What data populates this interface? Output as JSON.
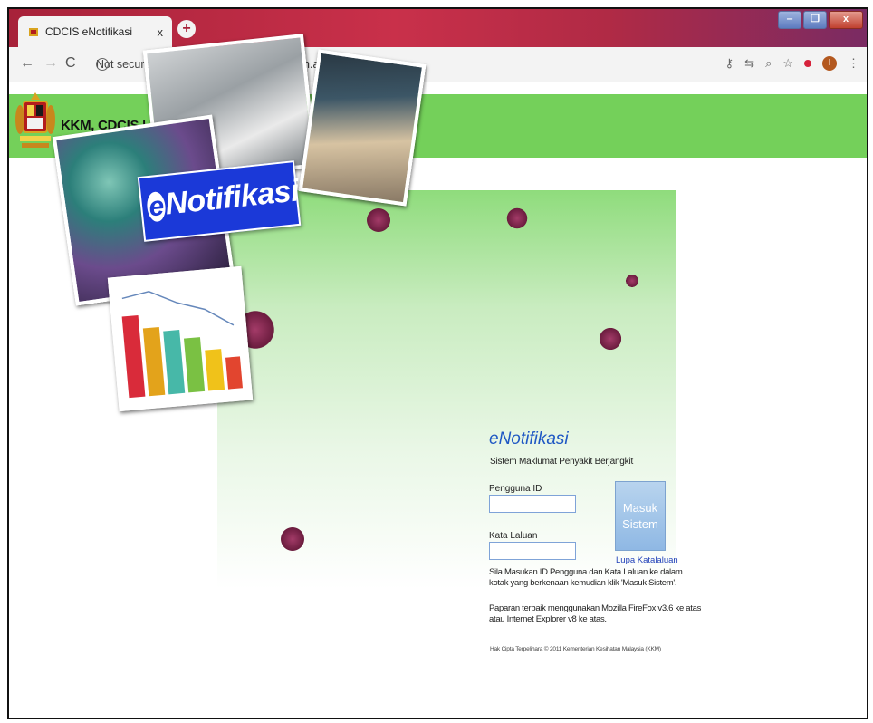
{
  "browser": {
    "tab_title": "CDCIS eNotifikasi",
    "tab_close": "x",
    "new_tab": "+",
    "win_min": "‒",
    "win_max": "❐",
    "win_close": "x",
    "security_label": "Not secure",
    "url": "enotifikasi.moh.gov.my/Login.aspx",
    "icons": [
      "key-icon",
      "translate-icon",
      "zoom-icon",
      "star-icon",
      "extension-icon",
      "profile-icon",
      "menu-icon"
    ],
    "profile_initial": "I"
  },
  "header": {
    "title": "KKM, CDCIS | e-Notifikasi",
    "bg_color": "#74d05a"
  },
  "splash": {
    "banner_e": "e",
    "banner_word": "Notifikasi"
  },
  "login": {
    "app_name": "eNotifikasi",
    "app_subtitle": "Sistem Maklumat Penyakit Berjangkit",
    "user_label": "Pengguna ID",
    "user_value": "",
    "password_label": "Kata Laluan",
    "password_value": "",
    "submit_line1": "Masuk",
    "submit_line2": "Sistem",
    "forgot_link": "Lupa Katalaluan",
    "instruction_1": "Sila Masukan ID Pengguna dan Kata Laluan ke dalam",
    "instruction_2": "kotak yang berkenaan kemudian klik 'Masuk Sistem'.",
    "browser_note_1": "Paparan terbaik menggunakan Mozilla FireFox v3.6 ke atas",
    "browser_note_2": "atau Internet Explorer v8 ke atas.",
    "copyright": "Hak Cipta Terpelihara © 2011 Kementerian Kesihatan Malaysia (KKM)"
  }
}
